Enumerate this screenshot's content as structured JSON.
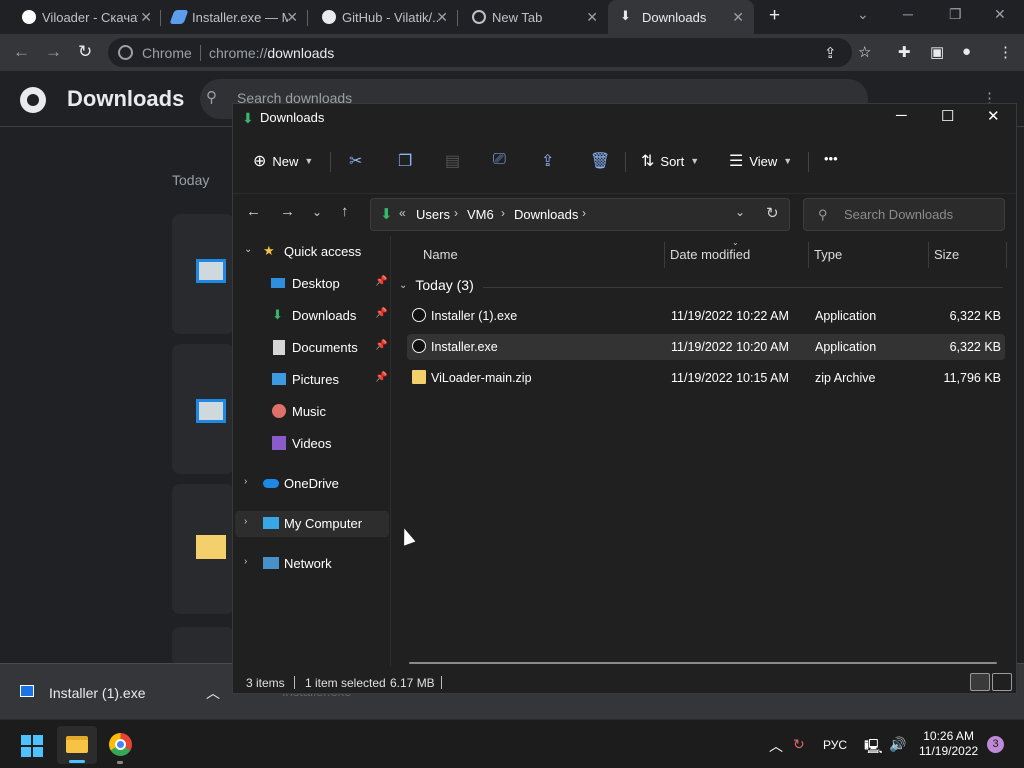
{
  "browser": {
    "tabs": [
      {
        "label": "Viloader - Скачать",
        "icon": "viloader-icon"
      },
      {
        "label": "Installer.exe — Mega",
        "icon": "mega-icon"
      },
      {
        "label": "GitHub - Vilatik/...",
        "icon": "github-icon"
      },
      {
        "label": "New Tab",
        "icon": "chrome-icon"
      },
      {
        "label": "Downloads",
        "icon": "download-icon",
        "active": true
      }
    ],
    "site_label": "Chrome",
    "url_prefix": "chrome://",
    "url_path": "downloads"
  },
  "downloads_page": {
    "title": "Downloads",
    "search_placeholder": "Search downloads",
    "group_label": "Today"
  },
  "shelf": {
    "item_name": "Installer (1).exe",
    "ghost_name": "Installer.exe"
  },
  "explorer": {
    "title": "Downloads",
    "commands": {
      "new": "New",
      "sort": "Sort",
      "view": "View",
      "more": "•••"
    },
    "breadcrumbs": [
      "Users",
      "VM6",
      "Downloads"
    ],
    "search_placeholder": "Search Downloads",
    "nav": {
      "quick_access": "Quick access",
      "desktop": "Desktop",
      "downloads": "Downloads",
      "documents": "Documents",
      "pictures": "Pictures",
      "music": "Music",
      "videos": "Videos",
      "onedrive": "OneDrive",
      "my_computer": "My Computer",
      "network": "Network"
    },
    "columns": [
      "Name",
      "Date modified",
      "Type",
      "Size"
    ],
    "group": "Today (3)",
    "files": [
      {
        "name": "Installer (1).exe",
        "date": "11/19/2022 10:22 AM",
        "type": "Application",
        "size": "6,322 KB"
      },
      {
        "name": "Installer.exe",
        "date": "11/19/2022 10:20 AM",
        "type": "Application",
        "size": "6,322 KB"
      },
      {
        "name": "ViLoader-main.zip",
        "date": "11/19/2022 10:15 AM",
        "type": "zip Archive",
        "size": "11,796 KB"
      }
    ],
    "status": {
      "items": "3 items",
      "selected": "1 item selected",
      "size": "6.17 MB"
    }
  },
  "taskbar": {
    "language": "РУС",
    "time": "10:26 AM",
    "date": "11/19/2022",
    "notifications": "3"
  },
  "colors": {
    "accent": "#4cc2ff",
    "explorer_bg": "#202020",
    "chrome_bg": "#202124"
  }
}
